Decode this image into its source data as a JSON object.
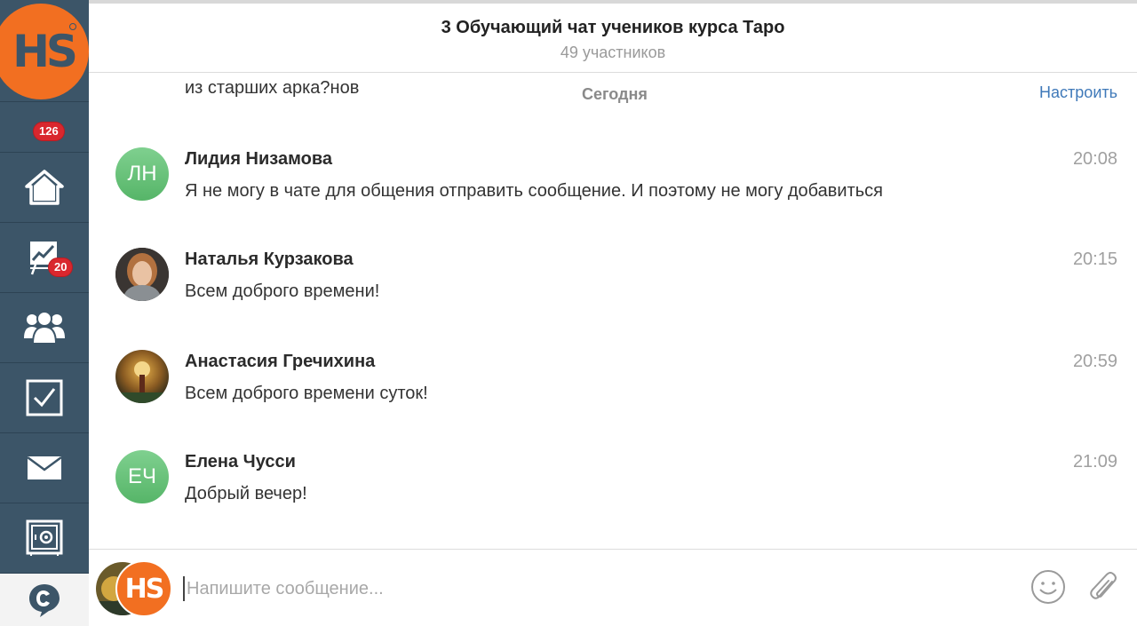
{
  "header": {
    "title": "3 Обучающий чат учеников курса Таро",
    "subtitle": "49 участников"
  },
  "sidebar": {
    "logo_text": "HS",
    "notifications_count": "126",
    "items": [
      {
        "icon": "home-icon"
      },
      {
        "icon": "presentation-icon",
        "badge": "20"
      },
      {
        "icon": "users-icon"
      },
      {
        "icon": "checkbox-icon"
      },
      {
        "icon": "mail-icon"
      },
      {
        "icon": "safe-icon"
      },
      {
        "icon": "chat-icon",
        "active": true
      }
    ]
  },
  "chat": {
    "previous_message_tail": "из старших арка?нов",
    "date_separator": "Сегодня",
    "configure_link": "Настроить",
    "messages": [
      {
        "author": "Лидия Низамова",
        "initials": "ЛН",
        "time": "20:08",
        "text": "Я не могу в чате для общения отправить сообщение. И поэтому не могу добавиться"
      },
      {
        "author": "Наталья Курзакова",
        "time": "20:15",
        "text": "Всем доброго времени!"
      },
      {
        "author": "Анастасия Гречихина",
        "time": "20:59",
        "text": "Всем доброго времени суток!"
      },
      {
        "author": "Елена Чусси",
        "initials": "ЕЧ",
        "time": "21:09",
        "text": "Добрый вечер!"
      }
    ]
  },
  "composer": {
    "placeholder": "Напишите сообщение...",
    "avatar_text": "HS"
  },
  "colors": {
    "sidebar": "#3c5568",
    "accent_orange": "#f26f21",
    "badge_red": "#d9272e",
    "link_blue": "#3f79b9"
  }
}
